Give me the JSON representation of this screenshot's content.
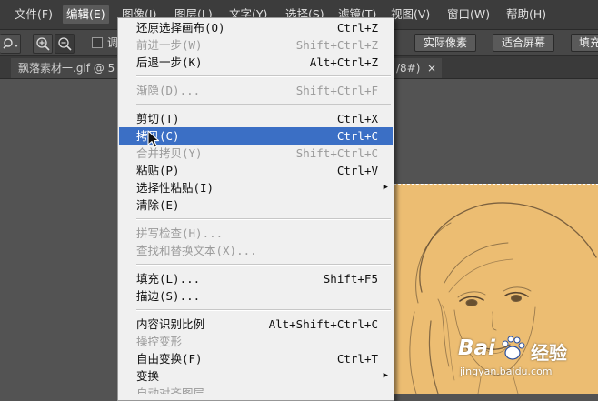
{
  "menubar": {
    "items": [
      {
        "label": "文件(F)",
        "active": false
      },
      {
        "label": "编辑(E)",
        "active": true
      },
      {
        "label": "图像(I)",
        "active": false
      },
      {
        "label": "图层(L)",
        "active": false
      },
      {
        "label": "文字(Y)",
        "active": false
      },
      {
        "label": "选择(S)",
        "active": false
      },
      {
        "label": "滤镜(T)",
        "active": false
      },
      {
        "label": "视图(V)",
        "active": false
      },
      {
        "label": "窗口(W)",
        "active": false
      },
      {
        "label": "帮助(H)",
        "active": false
      }
    ]
  },
  "options": {
    "zoom_in_icon": "zoom-in-icon",
    "zoom_out_icon": "zoom-out-icon",
    "checkbox_partial_label": "调",
    "buttons": [
      "实际像素",
      "适合屏幕",
      "填充"
    ]
  },
  "tabs": {
    "doc_tab_label": "飘落素材一.gif @ 5",
    "doc_tab_tail": "/8#)",
    "close_glyph": "×"
  },
  "edit_menu": {
    "highlight_color": "#3b6fc5",
    "groups": [
      [
        {
          "label": "还原选择画布(O)",
          "shortcut": "Ctrl+Z",
          "disabled": false
        },
        {
          "label": "前进一步(W)",
          "shortcut": "Shift+Ctrl+Z",
          "disabled": true
        },
        {
          "label": "后退一步(K)",
          "shortcut": "Alt+Ctrl+Z",
          "disabled": false
        }
      ],
      [
        {
          "label": "渐隐(D)...",
          "shortcut": "Shift+Ctrl+F",
          "disabled": true
        }
      ],
      [
        {
          "label": "剪切(T)",
          "shortcut": "Ctrl+X",
          "disabled": false
        },
        {
          "label": "拷贝(C)",
          "shortcut": "Ctrl+C",
          "disabled": false,
          "highlight": true
        },
        {
          "label": "合并拷贝(Y)",
          "shortcut": "Shift+Ctrl+C",
          "disabled": true
        },
        {
          "label": "粘贴(P)",
          "shortcut": "Ctrl+V",
          "disabled": false
        },
        {
          "label": "选择性粘贴(I)",
          "shortcut": "",
          "disabled": false,
          "submenu": true
        },
        {
          "label": "清除(E)",
          "shortcut": "",
          "disabled": false
        }
      ],
      [
        {
          "label": "拼写检查(H)...",
          "shortcut": "",
          "disabled": true
        },
        {
          "label": "查找和替换文本(X)...",
          "shortcut": "",
          "disabled": true
        }
      ],
      [
        {
          "label": "填充(L)...",
          "shortcut": "Shift+F5",
          "disabled": false
        },
        {
          "label": "描边(S)...",
          "shortcut": "",
          "disabled": false
        }
      ],
      [
        {
          "label": "内容识别比例",
          "shortcut": "Alt+Shift+Ctrl+C",
          "disabled": false
        },
        {
          "label": "操控变形",
          "shortcut": "",
          "disabled": true
        },
        {
          "label": "自由变换(F)",
          "shortcut": "Ctrl+T",
          "disabled": false
        },
        {
          "label": "变换",
          "shortcut": "",
          "disabled": false,
          "submenu": true
        },
        {
          "label": "自动对齐图层",
          "shortcut": "",
          "disabled": true
        }
      ]
    ],
    "submenu_arrow": "▶"
  },
  "watermark": {
    "brand": "Bai",
    "brand_suffix": "经验",
    "url": "jingyan.baidu.com",
    "icon": "baidu-paw-icon"
  },
  "colors": {
    "menubar_bg": "#3c3c3c",
    "canvas_bg": "#ecbd72",
    "highlight": "#3b6fc5"
  }
}
